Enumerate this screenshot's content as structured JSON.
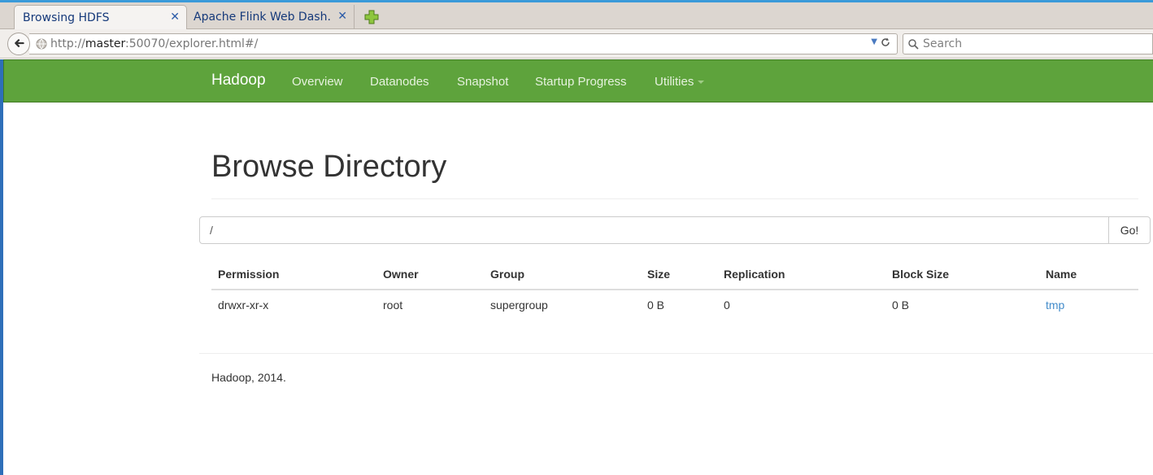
{
  "browser": {
    "tabs": [
      {
        "label": "Browsing HDFS",
        "active": true
      },
      {
        "label": "Apache Flink Web Dash...",
        "active": false
      }
    ],
    "url_prefix": "http://",
    "url_host": "master",
    "url_rest": ":50070/explorer.html#/",
    "search_placeholder": "Search"
  },
  "navbar": {
    "brand": "Hadoop",
    "links": [
      "Overview",
      "Datanodes",
      "Snapshot",
      "Startup Progress",
      "Utilities"
    ],
    "color": "#5ea33c"
  },
  "main": {
    "title": "Browse Directory",
    "path_value": "/",
    "go_label": "Go!",
    "columns": [
      "Permission",
      "Owner",
      "Group",
      "Size",
      "Replication",
      "Block Size",
      "Name"
    ],
    "rows": [
      [
        "drwxr-xr-x",
        "root",
        "supergroup",
        "0 B",
        "0",
        "0 B",
        "tmp"
      ]
    ]
  },
  "footer": "Hadoop, 2014."
}
